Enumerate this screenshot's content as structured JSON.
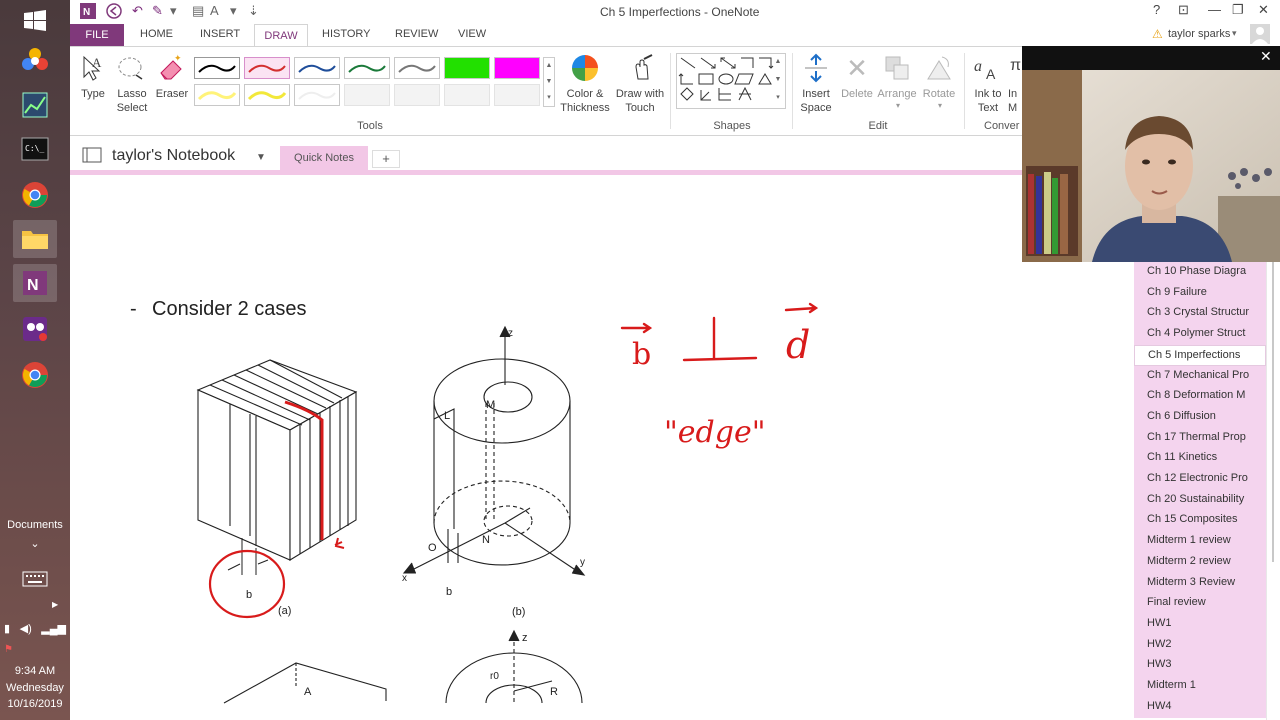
{
  "window": {
    "title": "Ch 5 Imperfections - OneNote",
    "user": "taylor sparks",
    "help": "?",
    "minimize": "—",
    "restore": "❐",
    "close": "✕"
  },
  "taskbar": {
    "documents_label": "Documents",
    "clock_time": "9:34 AM",
    "clock_day": "Wednesday",
    "clock_date": "10/16/2019"
  },
  "ribbon": {
    "tabs": [
      "FILE",
      "HOME",
      "INSERT",
      "DRAW",
      "HISTORY",
      "REVIEW",
      "VIEW"
    ],
    "tools": {
      "type": "Type",
      "lasso1": "Lasso",
      "lasso2": "Select",
      "eraser": "Eraser",
      "color1": "Color &",
      "color2": "Thickness",
      "drawtouch1": "Draw with",
      "drawtouch2": "Touch",
      "group": "Tools"
    },
    "pen_colors": [
      "#000000",
      "#d32f2f",
      "#1f4e9a",
      "#1b7a3a",
      "#777777",
      "#fff37a",
      "#f2e83a",
      "#ffffff"
    ],
    "highlighters": [
      "#22e000",
      "#ff00ff"
    ],
    "shapes_group": "Shapes",
    "edit": {
      "insert1": "Insert",
      "insert2": "Space",
      "delete": "Delete",
      "arrange": "Arrange",
      "rotate": "Rotate",
      "group": "Edit"
    },
    "convert": {
      "ink1": "Ink to",
      "ink2": "Text",
      "math1": "In",
      "math2": "M",
      "group": "Conver"
    }
  },
  "notebook": {
    "name": "taylor's Notebook",
    "section_tab": "Quick Notes",
    "add_tab": "+"
  },
  "page": {
    "bullet_dash": "-",
    "bullet_text": "Consider 2 cases",
    "fig_a": {
      "caption": "(a)",
      "b": "b"
    },
    "fig_b": {
      "caption": "(b)",
      "z": "z",
      "m": "M",
      "l": "L",
      "n": "N",
      "o": "O",
      "x": "x",
      "y": "y",
      "b": "b"
    },
    "fig_c": {
      "a": "A"
    },
    "fig_d": {
      "z": "z",
      "r0": "r0",
      "r": "R"
    },
    "ink": {
      "b": "b",
      "perp": "⊥",
      "d": "d",
      "edge": "\"edge\""
    },
    "ink_color": "#d81b1b"
  },
  "sections": [
    "Ch 10 Phase Diagra",
    "Ch 9 Failure",
    "Ch 3 Crystal Structur",
    "Ch 4 Polymer Struct",
    "Ch 5 Imperfections",
    "Ch 7 Mechanical Pro",
    "Ch 8 Deformation M",
    "Ch 6 Diffusion",
    "Ch 17 Thermal Prop",
    "Ch 11 Kinetics",
    "Ch 12 Electronic Pro",
    "Ch 20 Sustainability",
    "Ch 15 Composites",
    "Midterm 1 review",
    "Midterm 2 review",
    "Midterm 3 Review",
    "Final review",
    "HW1",
    "HW2",
    "HW3",
    "Midterm 1",
    "HW4"
  ],
  "active_section": "Ch 5 Imperfections",
  "colors": {
    "brand": "#80397b",
    "section_bg": "#f4d4ee",
    "tab_bar": "#f2c7e6"
  }
}
